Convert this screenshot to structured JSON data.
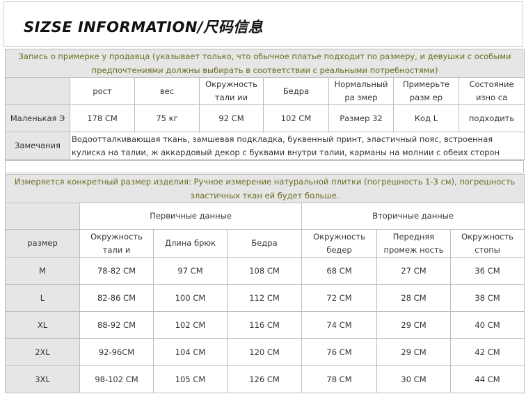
{
  "header": {
    "title": "SIZSE INFORMATION/尺码信息"
  },
  "fitting": {
    "note": "Запись о примерке у продавца (указывает только, что обычное платье подходит по размеру, и девушки с особыми предпочтениями должны выбирать в соответствии с реальными потребностями)",
    "headers": [
      "",
      "рост",
      "вес",
      "Окружность тали ии",
      "Бедра",
      "Нормальный ра змер",
      "Примерьте разм ер",
      "Состояние изно са"
    ],
    "row": [
      "Маленькая Э",
      "178 CM",
      "75 кг",
      "92 CM",
      "102 CM",
      "Размер 32",
      "Код L",
      "подходить"
    ],
    "remarks_label": "Замечания",
    "remarks_text": "Водоотталкивающая ткань, замшевая подкладка, буквенный принт, эластичный пояс, встроенная кулиска на талии, ж аккардовый декор с буквами внутри талии, карманы на молнии с обеих сторон"
  },
  "sizes": {
    "note": "Измеряется конкретный размер изделия: Ручное измерение натуральной плитки (погрешность 1-3 см), погрешность эластичных ткан ей будет больше.",
    "group_primary": "Первичные данные",
    "group_secondary": "Вторичные данные",
    "headers": [
      "размер",
      "Окружность тали и",
      "Длина брюк",
      "Бедра",
      "Окружность бедер",
      "Передняя промеж ность",
      "Окружность стопы"
    ],
    "rows": [
      [
        "M",
        "78-82 CM",
        "97 CM",
        "108 CM",
        "68 CM",
        "27 CM",
        "36 CM"
      ],
      [
        "L",
        "82-86 CM",
        "100 CM",
        "112 CM",
        "72 CM",
        "28 CM",
        "38 CM"
      ],
      [
        "XL",
        "88-92 CM",
        "102 CM",
        "116 CM",
        "74 CM",
        "29 CM",
        "40 CM"
      ],
      [
        "2XL",
        "92-96CM",
        "104 CM",
        "120 CM",
        "76 CM",
        "29 CM",
        "42 CM"
      ],
      [
        "3XL",
        "98-102 CM",
        "105 CM",
        "126 CM",
        "78 CM",
        "30 CM",
        "44 CM"
      ]
    ]
  }
}
